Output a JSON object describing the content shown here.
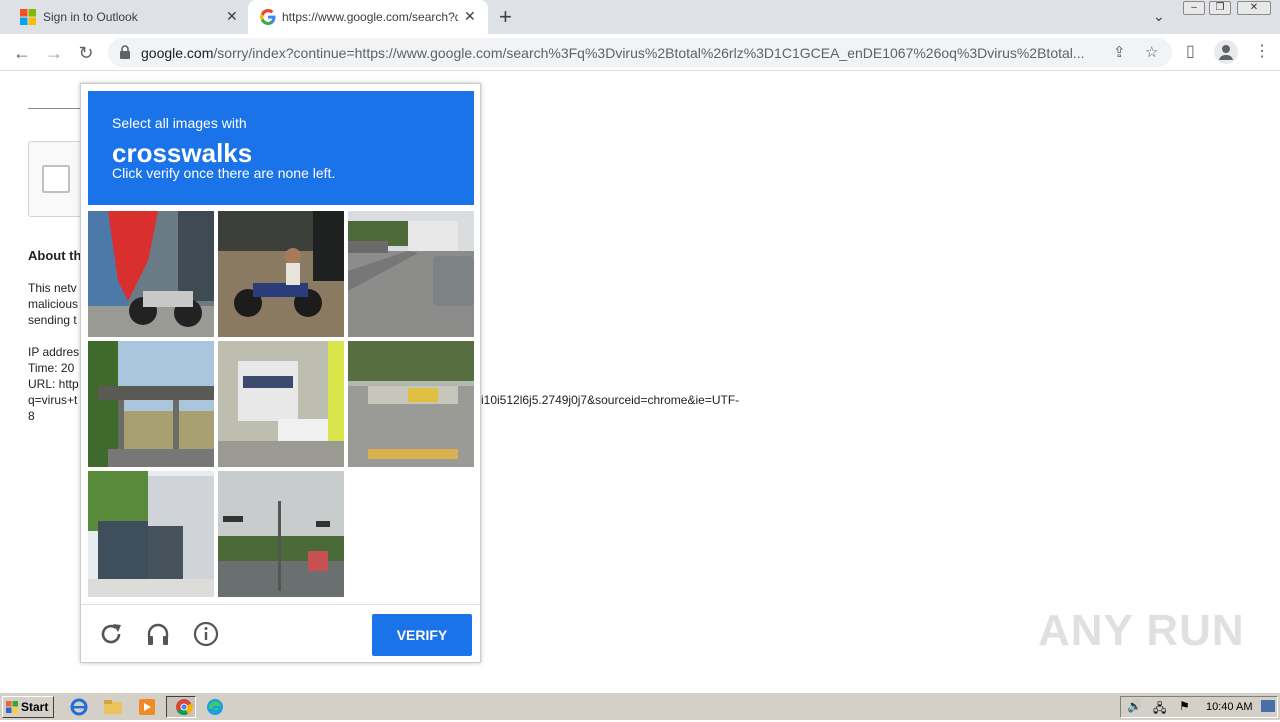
{
  "tabs": [
    {
      "title": "Sign in to Outlook",
      "active": false
    },
    {
      "title": "https://www.google.com/search?q=",
      "active": true
    }
  ],
  "toolbar": {
    "url_host": "google.com",
    "url_rest": "/sorry/index?continue=https://www.google.com/search%3Fq%3Dvirus%2Btotal%26rlz%3D1C1GCEA_enDE1067%26oq%3Dvirus%2Btotal..."
  },
  "page": {
    "about_heading": "About th",
    "para1": [
      "This netv",
      "malicious",
      "sending t"
    ],
    "ip_label": "IP addres",
    "time_label": "Time: 20",
    "url_label": "URL: http",
    "url_line2": "q=virus+t",
    "url_tail": "i10i512l6j5.2749j0j7&sourceid=chrome&ie=UTF-",
    "url_line3": "8"
  },
  "challenge": {
    "instruction_top": "Select all images with",
    "target": "crosswalks",
    "instruction_bottom": "Click verify once there are none left.",
    "tiles": [
      {
        "row": 1,
        "col": 1,
        "subject": "motorcycle and red flag"
      },
      {
        "row": 1,
        "col": 2,
        "subject": "person on motorcycle"
      },
      {
        "row": 1,
        "col": 3,
        "subject": "road with cars"
      },
      {
        "row": 2,
        "col": 1,
        "subject": "bridge"
      },
      {
        "row": 2,
        "col": 2,
        "subject": "bus and car"
      },
      {
        "row": 2,
        "col": 3,
        "subject": "median barrier"
      },
      {
        "row": 3,
        "col": 1,
        "subject": "trash bins"
      },
      {
        "row": 3,
        "col": 2,
        "subject": "traffic lights"
      }
    ],
    "verify_label": "VERIFY"
  },
  "watermark": "ANY RUN",
  "taskbar": {
    "start_label": "Start",
    "clock": "10:40 AM"
  },
  "colors": {
    "accent": "#1a73e8",
    "tabbar": "#dee1e6",
    "taskbar": "#d4d0c8"
  }
}
